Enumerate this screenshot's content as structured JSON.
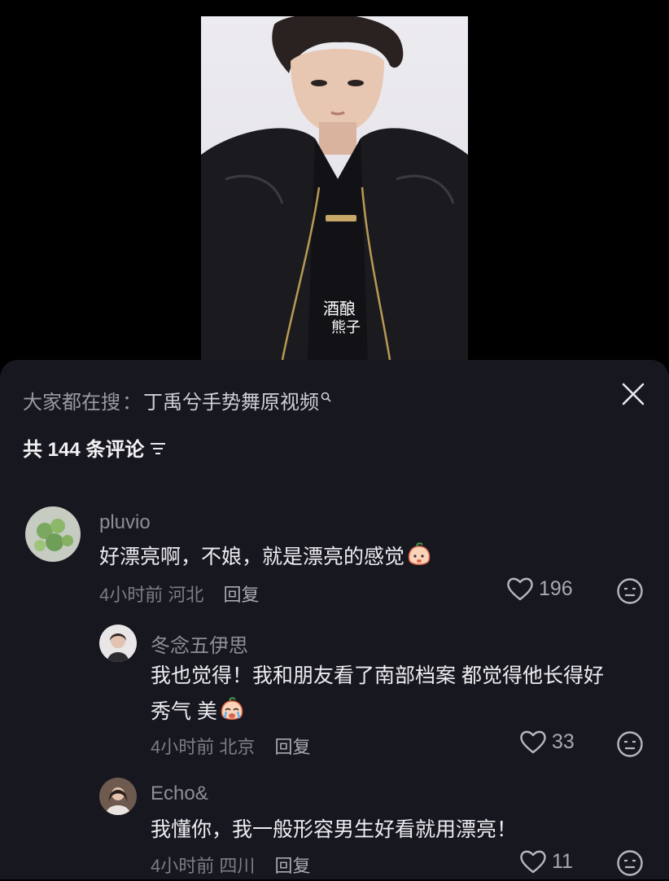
{
  "video": {
    "watermark_line1": "酒酿",
    "watermark_line2": "熊子"
  },
  "search": {
    "prefix": "大家都在搜",
    "separator": "：",
    "query": "丁禹兮手势舞原视频",
    "icon": "search-icon"
  },
  "comments_header": {
    "count_label": "共 144 条评论",
    "filter_icon": "filter-icon",
    "close_icon": "close-icon"
  },
  "comments": [
    {
      "username": "pluvio",
      "text": "好漂亮啊，不娘，就是漂亮的感觉",
      "emoji": "peach-face-emoji",
      "time": "4小时前",
      "location": "河北",
      "reply_label": "回复",
      "likes": "196"
    },
    {
      "username": "冬念五伊思",
      "text_line1": "我也觉得！我和朋友看了南部档案 都觉得他长得好",
      "text_line2": "秀气 美",
      "emoji": "crying-peach-emoji",
      "time": "4小时前",
      "location": "北京",
      "reply_label": "回复",
      "likes": "33"
    },
    {
      "username": "Echo&",
      "text": "我懂你，我一般形容男生好看就用漂亮！",
      "time": "4小时前",
      "location": "四川",
      "reply_label": "回复",
      "likes": "11"
    }
  ],
  "colors": {
    "panel_bg": "#17171f",
    "text_primary": "#ededf0",
    "text_secondary": "#8e8e96"
  }
}
